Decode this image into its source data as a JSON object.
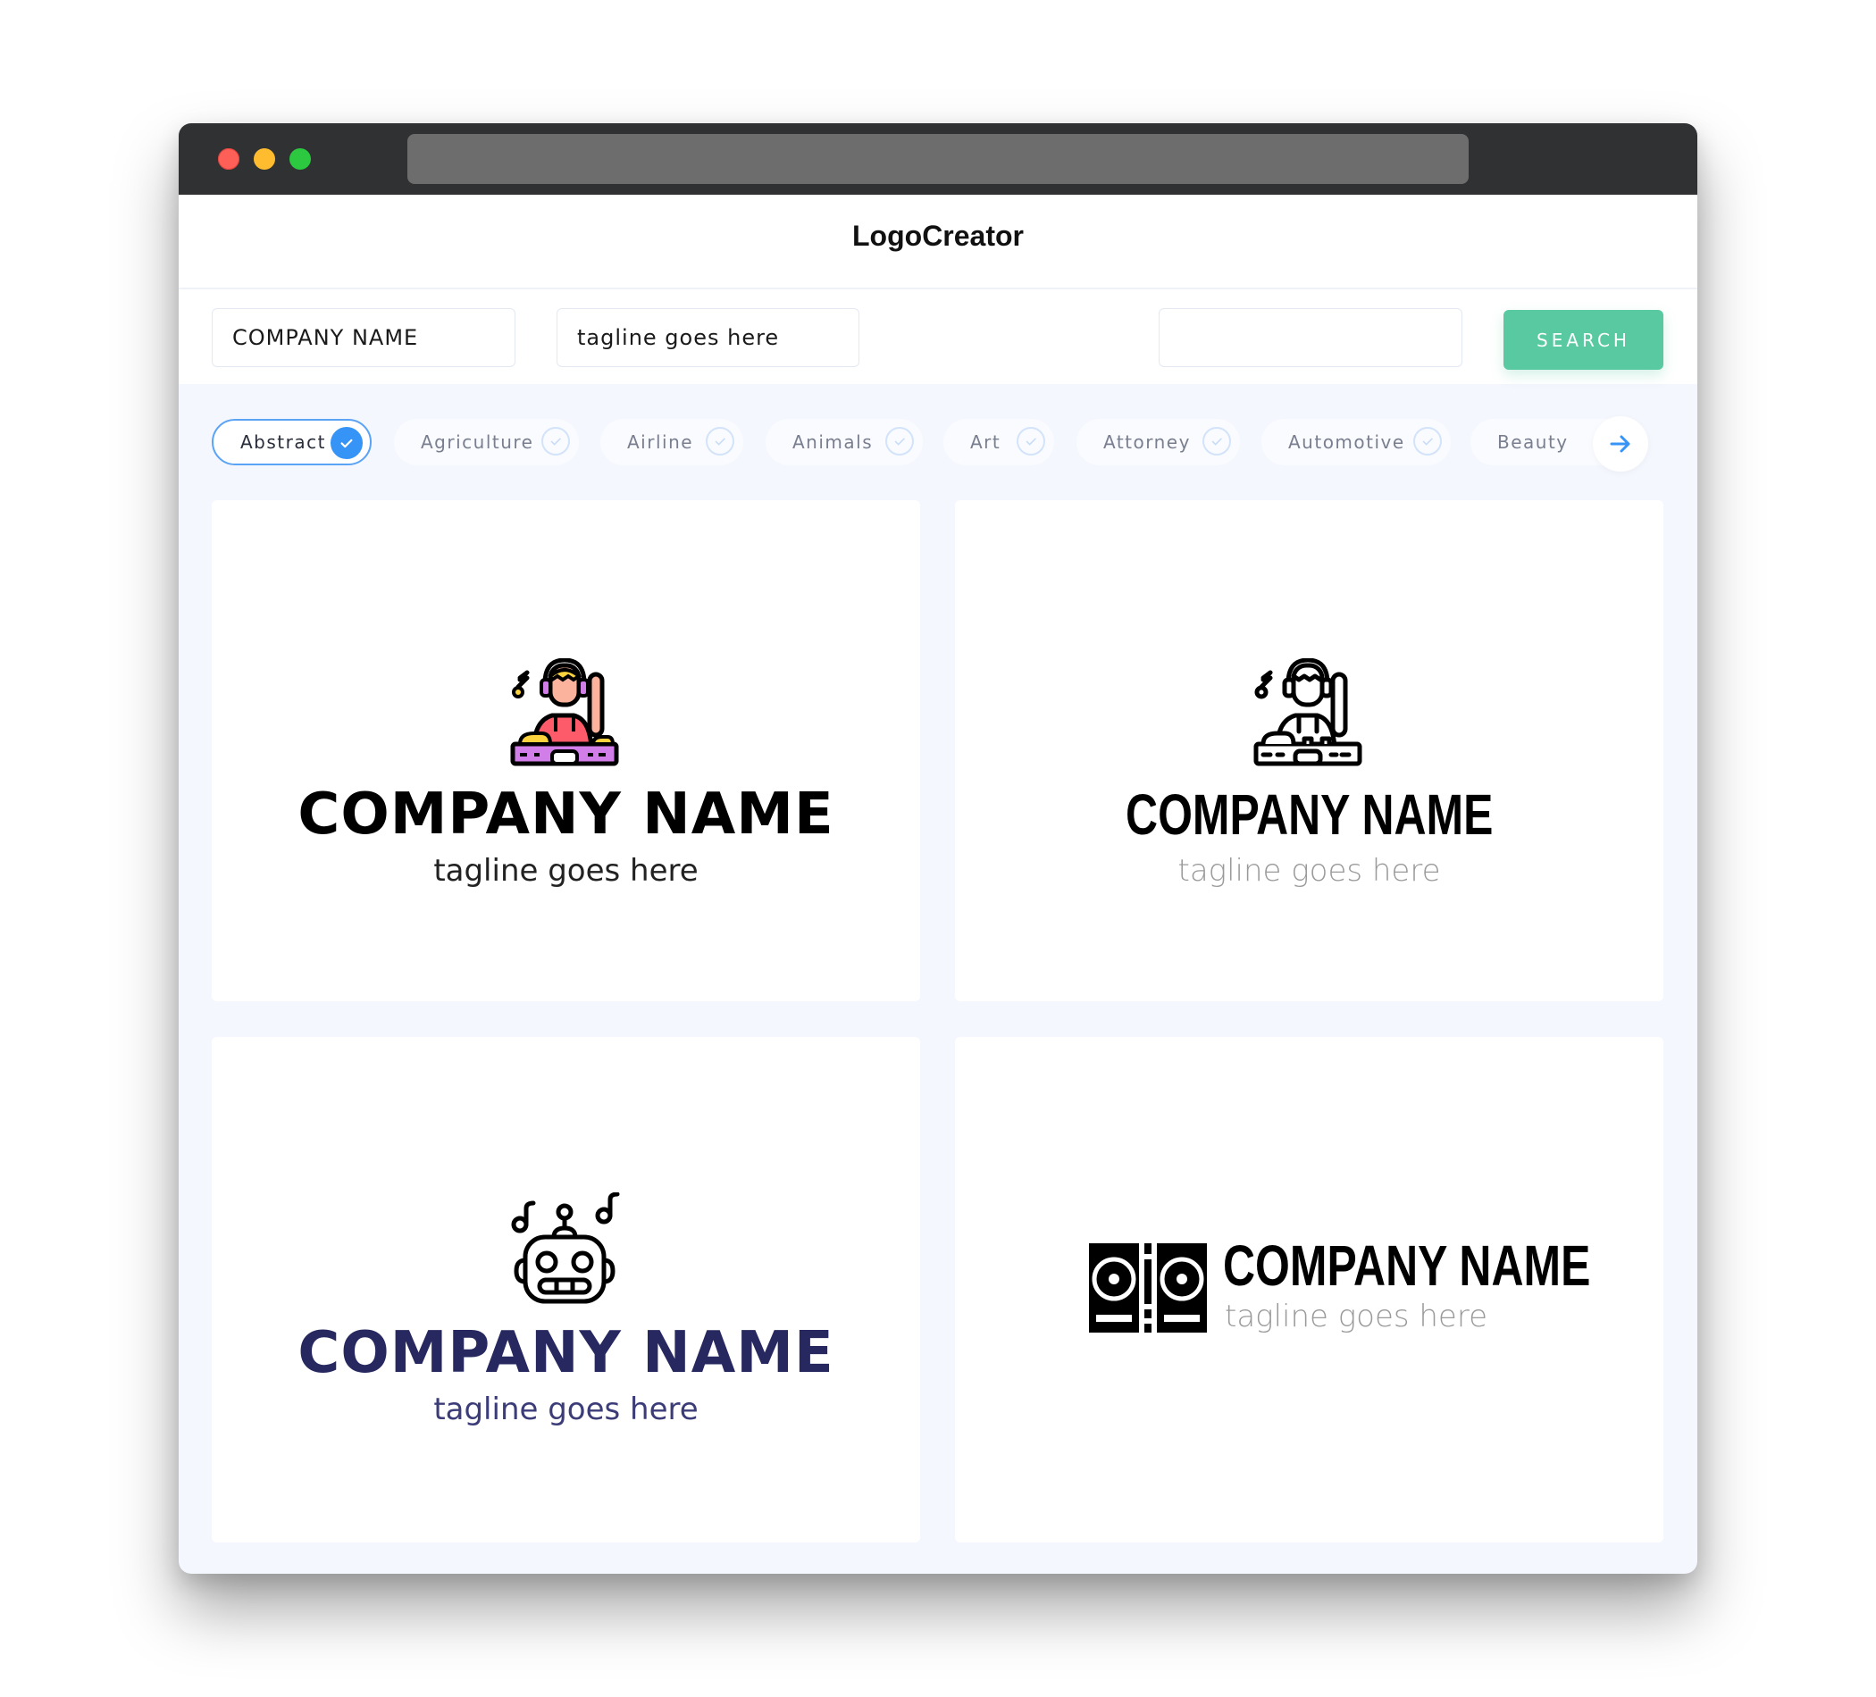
{
  "window": {
    "controls": [
      "close",
      "minimize",
      "maximize"
    ]
  },
  "header": {
    "title": "LogoCreator"
  },
  "search": {
    "company_value": "COMPANY NAME",
    "tagline_value": "tagline goes here",
    "extra_value": "",
    "button_label": "SEARCH"
  },
  "categories": [
    {
      "label": "Abstract",
      "selected": true
    },
    {
      "label": "Agriculture",
      "selected": false
    },
    {
      "label": "Airline",
      "selected": false
    },
    {
      "label": "Animals",
      "selected": false
    },
    {
      "label": "Art",
      "selected": false
    },
    {
      "label": "Attorney",
      "selected": false
    },
    {
      "label": "Automotive",
      "selected": false
    },
    {
      "label": "Beauty",
      "selected": false
    }
  ],
  "colors": {
    "accent_green": "#58c9a0",
    "accent_blue": "#3694f6",
    "navy": "#27285f",
    "dj_red": "#fd5b6a",
    "dj_purple": "#d27ee8",
    "dj_yellow": "#fdd33d",
    "dj_skin": "#fbb39e"
  },
  "logos": [
    {
      "icon": "dj-color-icon",
      "company": "COMPANY NAME",
      "tagline": "tagline goes here",
      "name_color": "#000000",
      "tagline_color": "#222222"
    },
    {
      "icon": "dj-outline-icon",
      "company": "COMPANY NAME",
      "tagline": "tagline goes here",
      "name_color": "#000000",
      "tagline_color": "#9a9a9a"
    },
    {
      "icon": "robot-music-icon",
      "company": "COMPANY NAME",
      "tagline": "tagline goes here",
      "name_color": "#27285f",
      "tagline_color": "#3b3c78"
    },
    {
      "icon": "turntable-icon",
      "company": "COMPANY NAME",
      "tagline": "tagline goes here",
      "name_color": "#000000",
      "tagline_color": "#9a9a9a"
    }
  ]
}
